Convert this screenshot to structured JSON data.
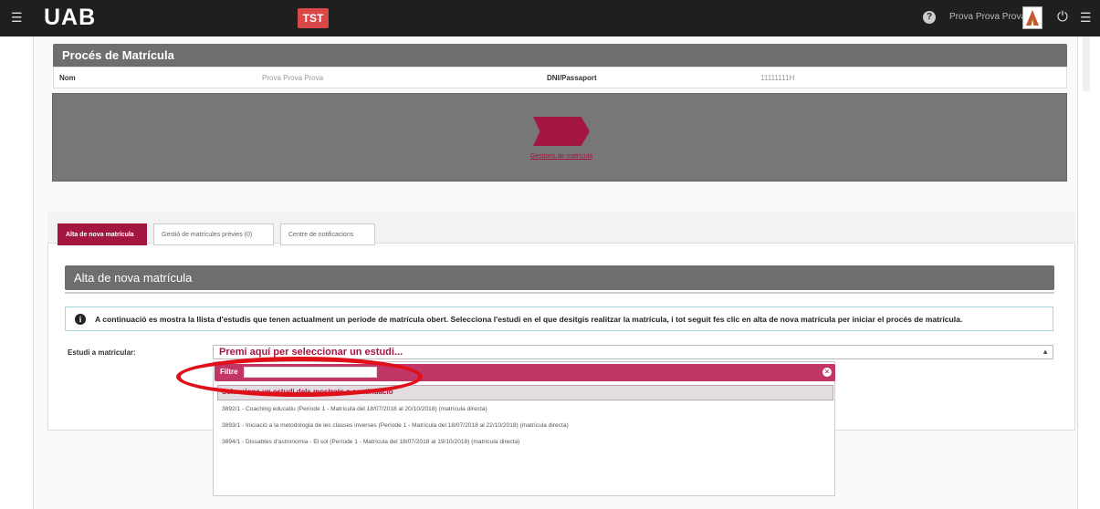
{
  "topbar": {
    "logo": "UAB",
    "env_badge": "TST",
    "user_name": "Prova Prova Prova ▾"
  },
  "proces": {
    "title": "Procés de Matrícula",
    "nom_label": "Nom",
    "nom_value": "Prova Prova Prova",
    "dni_label": "DNI/Passaport",
    "dni_value": "11111111H",
    "step_label": "Gestions de matrícula"
  },
  "tabs": [
    {
      "label": "Alta de nova matrícula"
    },
    {
      "label": "Gestió de matrícules prèvies (0)"
    },
    {
      "label": "Centre de notificacions"
    }
  ],
  "alta": {
    "title": "Alta de nova matrícula",
    "info": "A continuació es mostra la llista d'estudis que tenen actualment un període de matrícula obert. Selecciona l'estudi en el que desitgis realitzar la matrícula, i tot seguit fes clic en alta de nova matrícula per iniciar el procés de matrícula.",
    "estudi_label": "Estudi a matricular:",
    "select_placeholder": "Premi aquí per seleccionar un estudi..."
  },
  "dropdown": {
    "filter_label": "Filtre",
    "filter_value": "",
    "group_label": "Selecciona un estudi dels mostrats a continuació",
    "options": [
      "3892/1 - Coaching educatiu (Període 1 - Matrícula del 18/07/2018 al 20/10/2018) (matrícula directa)",
      "3893/1 - Iniciació a la metodologia de les classes inverses (Període 1 - Matrícula del 18/07/2018 al 22/10/2018) (matrícula directa)",
      "3894/1 - Dissabtes d'astronomia - El sol (Període 1 - Matrícula del 18/07/2018 al 19/10/2018) (matrícula directa)"
    ]
  },
  "colors": {
    "brand": "#a3163f",
    "filter_bar": "#c23567",
    "header_gray": "#6e6e6e",
    "topbar": "#1f1f1f",
    "highlight_ellipse": "#e0101a"
  }
}
